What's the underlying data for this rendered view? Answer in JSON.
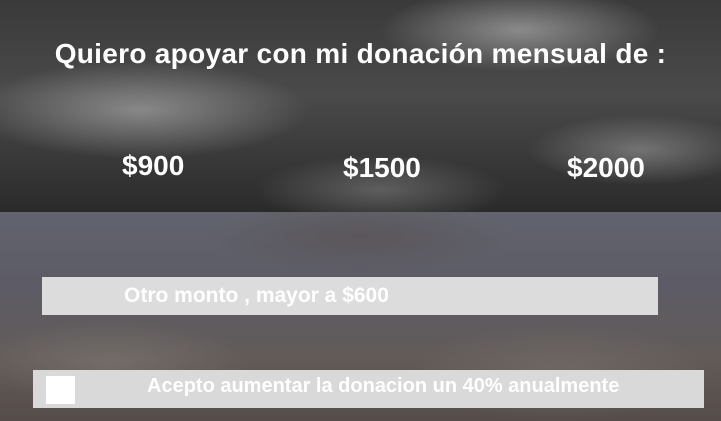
{
  "header": {
    "title": "Quiero apoyar con mi donación mensual de :"
  },
  "amounts": [
    {
      "label": "$900"
    },
    {
      "label": "$1500"
    },
    {
      "label": "$2000"
    }
  ],
  "other_amount": {
    "placeholder": "Otro monto , mayor a $600",
    "value": ""
  },
  "annual_increase": {
    "label": "Acepto aumentar la donacion un 40% anualmente",
    "checked": false
  }
}
